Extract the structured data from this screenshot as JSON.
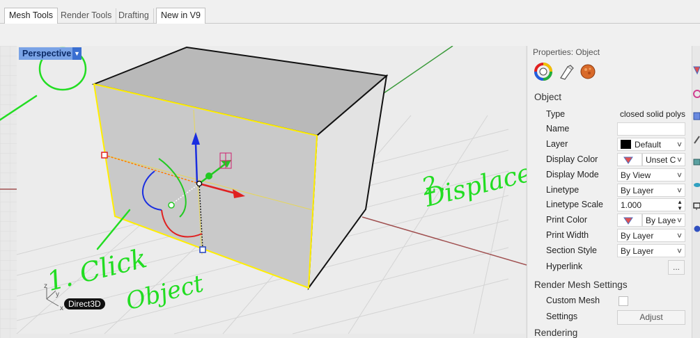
{
  "tabs": [
    {
      "label": "Mesh Tools",
      "active": true
    },
    {
      "label": "Render Tools",
      "active": false
    },
    {
      "label": "Drafting",
      "active": false
    },
    {
      "label": "New in V9",
      "active": false
    }
  ],
  "viewport": {
    "label": "Perspective",
    "renderer_badge": "Direct3D",
    "axis_x": "x",
    "axis_y": "y",
    "axis_z": "z"
  },
  "annotations": {
    "step1_line1": "1. Click",
    "step1_line2": "Object",
    "step2_line1": "2.",
    "step2_line2": "Displace"
  },
  "panel": {
    "title": "Properties: Object",
    "object_section": "Object",
    "rows": {
      "type_label": "Type",
      "type_value": "closed solid polys",
      "name_label": "Name",
      "name_value": "",
      "layer_label": "Layer",
      "layer_value": "Default",
      "display_color_label": "Display Color",
      "display_color_value": "Unset C",
      "display_mode_label": "Display Mode",
      "display_mode_value": "By View",
      "linetype_label": "Linetype",
      "linetype_value": "By Layer",
      "linetype_scale_label": "Linetype Scale",
      "linetype_scale_value": "1.000",
      "print_color_label": "Print Color",
      "print_color_value": "By Laye",
      "print_width_label": "Print Width",
      "print_width_value": "By Layer",
      "section_style_label": "Section Style",
      "section_style_value": "By Layer",
      "hyperlink_label": "Hyperlink",
      "hyperlink_button": "..."
    },
    "render_mesh_section": "Render Mesh Settings",
    "custom_mesh_label": "Custom Mesh",
    "settings_label": "Settings",
    "adjust_button": "Adjust",
    "rendering_section": "Rendering"
  },
  "colors": {
    "annotation_green": "#22dd22",
    "selection_yellow": "#ffee00",
    "viewport_tab": "#7aa3e6"
  }
}
